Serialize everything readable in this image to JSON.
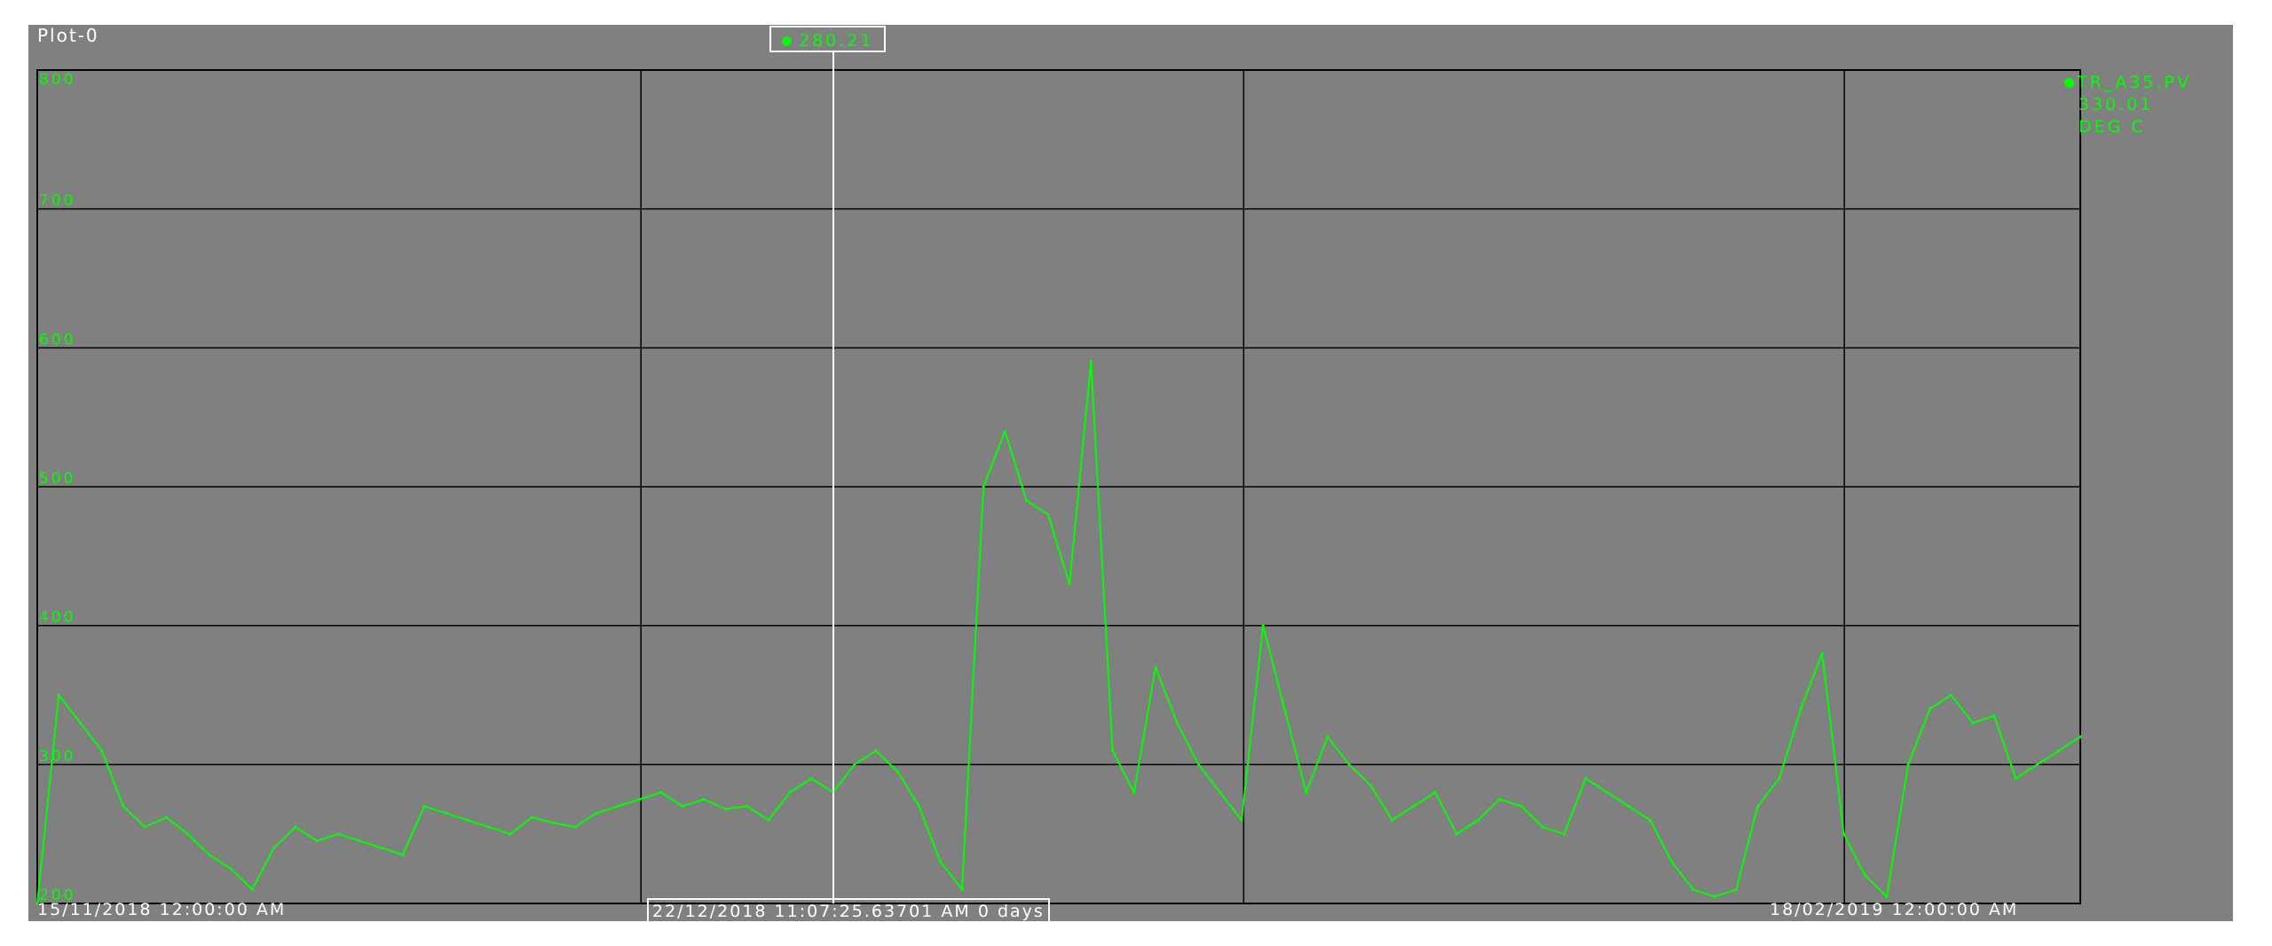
{
  "window": {
    "plot_title": "Plot-0",
    "background_color": "#808080",
    "grid_color": "#000000",
    "cursor_color": "#ffffff"
  },
  "cursor": {
    "value_readout": "280.21",
    "time_readout": "22/12/2018 11:07:25.63701 AM 0 days"
  },
  "legend": {
    "tag": "TR_A35.PV",
    "current_value": "330.01",
    "units": "DEG C",
    "color": "#00ff00"
  },
  "axis": {
    "x_start_label": "15/11/2018 12:00:00 AM",
    "x_end_label": "18/02/2019 12:00:00 AM"
  },
  "chart_data": {
    "type": "line",
    "title": "",
    "xlabel": "",
    "ylabel": "",
    "xlim": [
      "2018-11-15",
      "2019-02-18"
    ],
    "ylim": [
      200,
      800
    ],
    "yticks": [
      "200",
      "300",
      "400",
      "500",
      "600",
      "700",
      "800"
    ],
    "grid": true,
    "legend_position": "right",
    "series": [
      {
        "name": "TR_A35.PV",
        "color": "#00ff00",
        "x": [
          "2018-11-15",
          "2018-11-16",
          "2018-11-17",
          "2018-11-18",
          "2018-11-19",
          "2018-11-20",
          "2018-11-21",
          "2018-11-22",
          "2018-11-23",
          "2018-11-24",
          "2018-11-25",
          "2018-11-26",
          "2018-11-27",
          "2018-11-28",
          "2018-11-29",
          "2018-11-30",
          "2018-12-01",
          "2018-12-02",
          "2018-12-03",
          "2018-12-04",
          "2018-12-05",
          "2018-12-06",
          "2018-12-07",
          "2018-12-08",
          "2018-12-09",
          "2018-12-10",
          "2018-12-11",
          "2018-12-12",
          "2018-12-13",
          "2018-12-14",
          "2018-12-15",
          "2018-12-16",
          "2018-12-17",
          "2018-12-18",
          "2018-12-19",
          "2018-12-20",
          "2018-12-21",
          "2018-12-22",
          "2018-12-23",
          "2018-12-24",
          "2018-12-25",
          "2018-12-26",
          "2018-12-27",
          "2018-12-28",
          "2018-12-29",
          "2018-12-30",
          "2018-12-31",
          "2019-01-01",
          "2019-01-02",
          "2019-01-03",
          "2019-01-04",
          "2019-01-05",
          "2019-01-06",
          "2019-01-07",
          "2019-01-08",
          "2019-01-09",
          "2019-01-10",
          "2019-01-11",
          "2019-01-12",
          "2019-01-13",
          "2019-01-14",
          "2019-01-15",
          "2019-01-16",
          "2019-01-17",
          "2019-01-18",
          "2019-01-19",
          "2019-01-20",
          "2019-01-21",
          "2019-01-22",
          "2019-01-23",
          "2019-01-24",
          "2019-01-25",
          "2019-01-26",
          "2019-01-27",
          "2019-01-28",
          "2019-01-29",
          "2019-01-30",
          "2019-01-31",
          "2019-02-01",
          "2019-02-02",
          "2019-02-03",
          "2019-02-04",
          "2019-02-05",
          "2019-02-06",
          "2019-02-07",
          "2019-02-08",
          "2019-02-09",
          "2019-02-10",
          "2019-02-11",
          "2019-02-12",
          "2019-02-13",
          "2019-02-14",
          "2019-02-15",
          "2019-02-16",
          "2019-02-17",
          "2019-02-18"
        ],
        "y": [
          200,
          350,
          330,
          310,
          270,
          255,
          262,
          250,
          235,
          225,
          210,
          240,
          255,
          245,
          250,
          245,
          240,
          235,
          270,
          265,
          260,
          255,
          250,
          262,
          258,
          255,
          265,
          270,
          275,
          280,
          270,
          275,
          268,
          270,
          260,
          280,
          290,
          280,
          300,
          310,
          295,
          270,
          230,
          210,
          500,
          540,
          490,
          480,
          430,
          590,
          310,
          280,
          370,
          330,
          300,
          280,
          260,
          400,
          340,
          280,
          320,
          300,
          285,
          260,
          270,
          280,
          250,
          260,
          275,
          270,
          255,
          250,
          290,
          280,
          270,
          260,
          230,
          210,
          205,
          210,
          270,
          290,
          340,
          380,
          250,
          220,
          205,
          300,
          340,
          350,
          330,
          335,
          290,
          300,
          310,
          320
        ]
      }
    ]
  }
}
